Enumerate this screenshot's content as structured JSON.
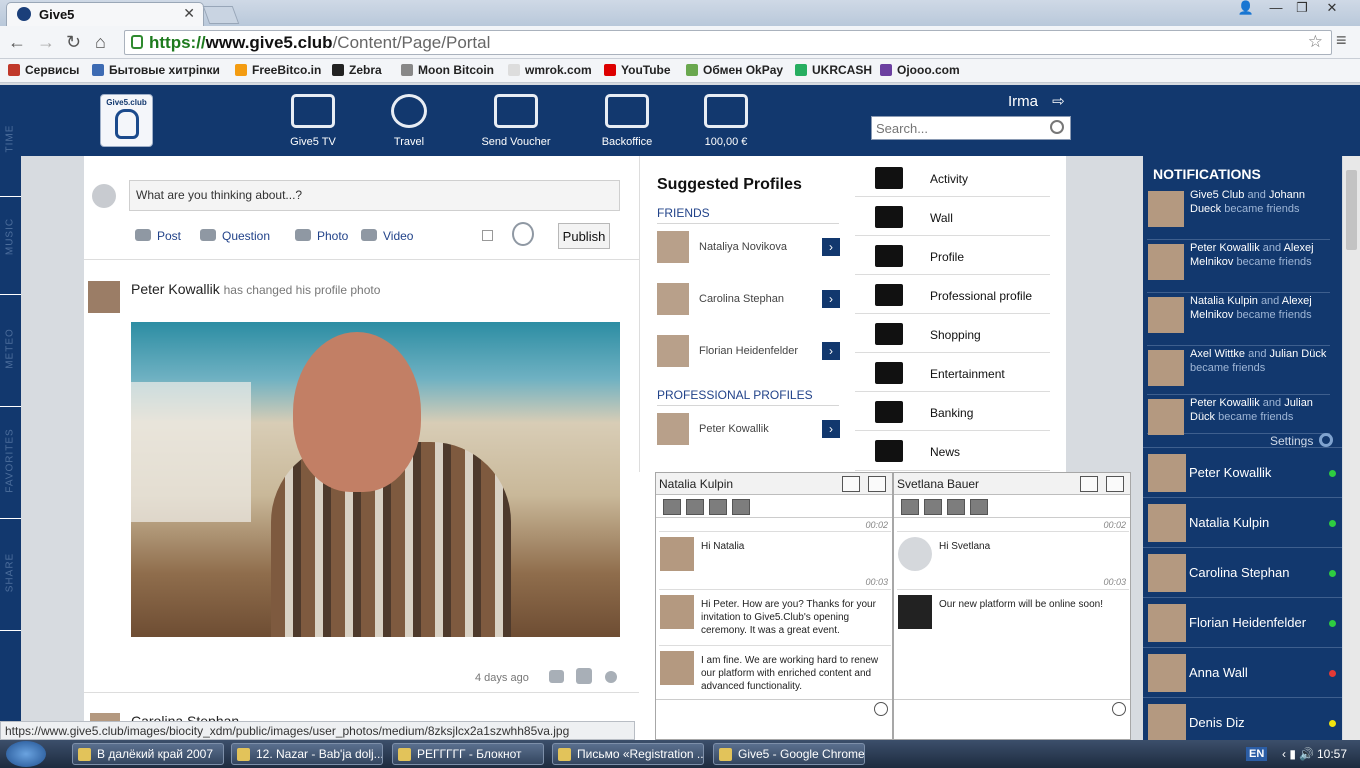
{
  "browser": {
    "tab_title": "Give5",
    "url_scheme": "https://",
    "url_host": "www.give5.club",
    "url_path": "/Content/Page/Portal",
    "bookmarks": [
      "Сервисы",
      "Бытовые хитрinки",
      "FreeBitco.in",
      "Zebra",
      "Moon Bitcoin",
      "wmrok.com",
      "YouTube",
      "Обмен OkPay",
      "UKRCASH",
      "Ojooo.com"
    ],
    "bookmark_colors": [
      "#c0392b",
      "#3d6bb3",
      "#f39c12",
      "#222",
      "#888",
      "#ddd",
      "#d00",
      "#6aa84f",
      "#27ae60",
      "#6b3fa0"
    ],
    "status_url": "https://www.give5.club/images/biocity_xdm/public/images/user_photos/medium/8zksjlcx2a1szwhh85va.jpg"
  },
  "header": {
    "logo_text": "Give5.club",
    "nav": [
      "Give5 TV",
      "Travel",
      "Send Voucher",
      "Backoffice",
      "100,00 €"
    ],
    "user": "Irma",
    "search_placeholder": "Search..."
  },
  "side_tabs": [
    "TIME",
    "MUSIC",
    "METEO",
    "FAVORITES",
    "SHARE"
  ],
  "composer": {
    "placeholder": "What are you thinking about...?",
    "actions": [
      "Post",
      "Question",
      "Photo",
      "Video"
    ],
    "publish": "Publish"
  },
  "feed": {
    "author": "Peter Kowallik",
    "action": "has changed his profile photo",
    "time": "4 days ago",
    "next_author": "Carolina Stephan"
  },
  "suggested": {
    "title": "Suggested Profiles",
    "friends_label": "FRIENDS",
    "friends": [
      "Nataliya Novikova",
      "Carolina Stephan",
      "Florian Heidenfelder"
    ],
    "pro_label": "PROFESSIONAL PROFILES",
    "pros": [
      "Peter Kowallik"
    ]
  },
  "menu": [
    "Activity",
    "Wall",
    "Profile",
    "Professional profile",
    "Shopping",
    "Entertainment",
    "Banking",
    "News"
  ],
  "notifications": {
    "title": "NOTIFICATIONS",
    "items": [
      {
        "a": "Give5 Club",
        "b": "Johann Dueck",
        "verb": "became friends"
      },
      {
        "a": "Peter Kowallik",
        "b": "Alexej Melnikov",
        "verb": "became friends"
      },
      {
        "a": "Natalia Kulpin",
        "b": "Alexej Melnikov",
        "verb": "became friends"
      },
      {
        "a": "Axel Wittke",
        "b": "Julian Dück",
        "verb": "became friends"
      },
      {
        "a": "Peter Kowallik",
        "b": "Julian Dück",
        "verb": "became friends"
      }
    ],
    "and": "and",
    "settings": "Settings"
  },
  "contacts": [
    {
      "name": "Peter Kowallik",
      "status": "#2ecc40"
    },
    {
      "name": "Natalia Kulpin",
      "status": "#2ecc40"
    },
    {
      "name": "Carolina Stephan",
      "status": "#2ecc40"
    },
    {
      "name": "Florian Heidenfelder",
      "status": "#2ecc40"
    },
    {
      "name": "Anna Wall",
      "status": "#e53935"
    },
    {
      "name": "Denis Diz",
      "status": "#f1e40f"
    }
  ],
  "chats": [
    {
      "name": "Natalia Kulpin",
      "time1": "00:02",
      "msg1": "Hi Natalia",
      "time2": "00:03",
      "msg2": "Hi Peter. How are you? Thanks for your invitation to Give5.Club's opening ceremony. It was a great event.",
      "msg3": "I am fine. We are working hard to renew our platform with enriched content and advanced functionality."
    },
    {
      "name": "Svetlana Bauer",
      "time1": "00:02",
      "msg1": "Hi Svetlana",
      "time2": "00:03",
      "msg2": "Our new platform will be online soon!"
    }
  ],
  "taskbar": {
    "tasks": [
      "В далёкий край 2007",
      "12. Nazar - Bab'ja dolj...",
      "РЕГГГГГ - Блокнот",
      "Письмо «Registration ...",
      "Give5 - Google Chrome"
    ],
    "lang": "EN",
    "clock": "10:57"
  }
}
